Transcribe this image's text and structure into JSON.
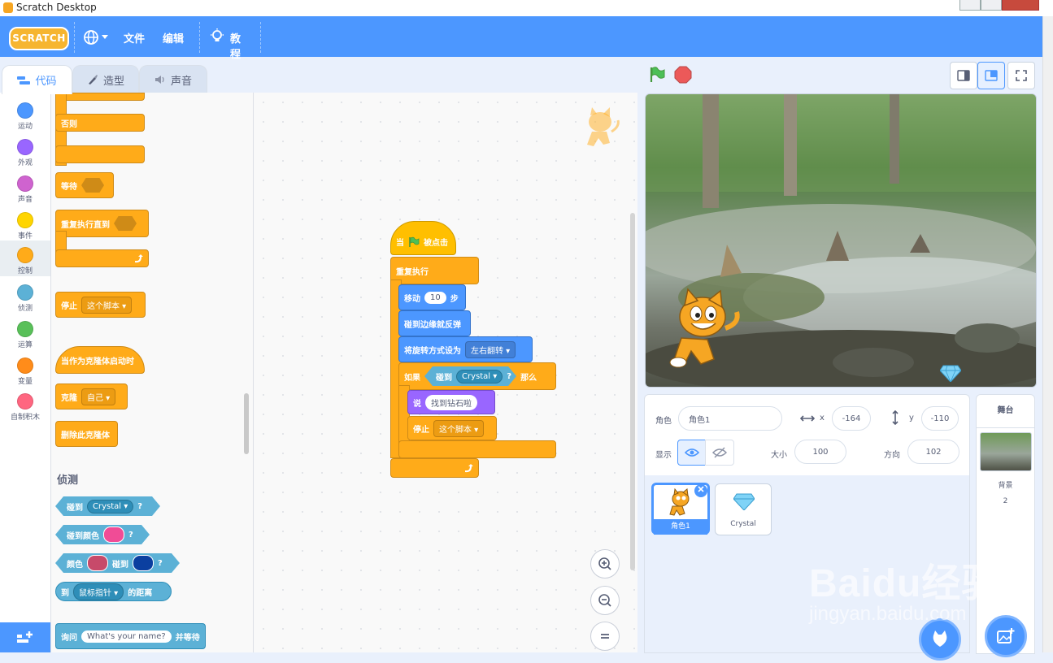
{
  "window": {
    "title": "Scratch Desktop"
  },
  "menubar": {
    "logo": "SCRATCH",
    "file": "文件",
    "edit": "编辑",
    "tutorials": "教程",
    "globe_icon": "globe-icon",
    "accent": "#4c97ff"
  },
  "tabs": {
    "code": "代码",
    "costumes": "造型",
    "sounds": "声音"
  },
  "categories": [
    {
      "label": "运动",
      "color": "#4c97ff"
    },
    {
      "label": "外观",
      "color": "#9966ff"
    },
    {
      "label": "声音",
      "color": "#cf63cf"
    },
    {
      "label": "事件",
      "color": "#ffd500"
    },
    {
      "label": "控制",
      "color": "#ffab19"
    },
    {
      "label": "侦测",
      "color": "#5cb1d6"
    },
    {
      "label": "运算",
      "color": "#59c059"
    },
    {
      "label": "变量",
      "color": "#ff8c1a"
    },
    {
      "label": "自制积木",
      "color": "#ff6680"
    }
  ],
  "palette": {
    "else": "否则",
    "wait": "等待",
    "repeat_until": "重复执行直到",
    "stop": "停止",
    "stop_option": "这个脚本",
    "when_clone": "当作为克隆体启动时",
    "clone": "克隆",
    "clone_option": "自己",
    "delete_clone": "删除此克隆体",
    "sensing_title": "侦测",
    "touching": "碰到",
    "touching_option": "Crystal",
    "touching_color": "碰到颜色",
    "color": "颜色",
    "touching2": "碰到",
    "qmark": "?",
    "distance_to": "到",
    "distance_option": "鼠标指针",
    "distance_suffix": "的距离",
    "ask": "询问",
    "ask_default": "What's your name?",
    "ask_suffix": "并等待"
  },
  "script": {
    "when": "当",
    "clicked": "被点击",
    "forever": "重复执行",
    "move": "移动",
    "move_steps": "10",
    "steps": "步",
    "bounce": "碰到边缘就反弹",
    "rotation": "将旋转方式设为",
    "rotation_option": "左右翻转",
    "if": "如果",
    "touching": "碰到",
    "touching_option": "Crystal",
    "qmark": "?",
    "then": "那么",
    "say": "说",
    "say_text": "找到钻石啦",
    "stop": "停止",
    "stop_option": "这个脚本"
  },
  "sprite_info": {
    "sprite_label": "角色",
    "sprite_name": "角色1",
    "x_label": "x",
    "x_value": "-164",
    "y_label": "y",
    "y_value": "-110",
    "show_label": "显示",
    "size_label": "大小",
    "size_value": "100",
    "direction_label": "方向",
    "direction_value": "102"
  },
  "sprites": [
    {
      "name": "角色1",
      "selected": true
    },
    {
      "name": "Crystal",
      "selected": false
    }
  ],
  "stage_panel": {
    "title": "舞台",
    "backdrop_label": "背景",
    "backdrop_count": "2"
  },
  "watermark": {
    "brand": "Baidu经验",
    "url": "jingyan.baidu.com"
  }
}
